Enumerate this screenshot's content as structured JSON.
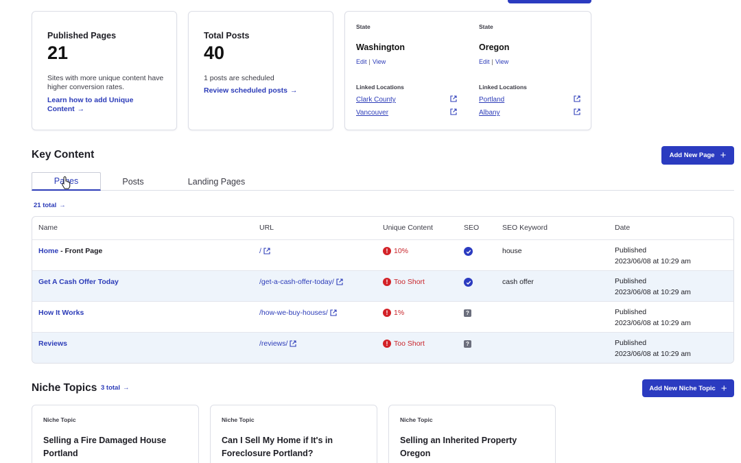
{
  "stats": {
    "published": {
      "title": "Published Pages",
      "value": "21",
      "desc": "Sites with more unique content have higher conversion rates.",
      "link": "Learn how to add Unique Content"
    },
    "posts": {
      "title": "Total Posts",
      "value": "40",
      "desc": "1 posts are scheduled",
      "link": "Review scheduled posts"
    }
  },
  "states": [
    {
      "label": "State",
      "name": "Washington",
      "edit": "Edit",
      "view": "View",
      "linked_label": "Linked Locations",
      "locations": [
        "Clark County",
        "Vancouver"
      ]
    },
    {
      "label": "State",
      "name": "Oregon",
      "edit": "Edit",
      "view": "View",
      "linked_label": "Linked Locations",
      "locations": [
        "Portland",
        "Albany"
      ]
    }
  ],
  "key_content": {
    "title": "Key Content",
    "add_button": "Add New Page",
    "tabs": [
      "Pages",
      "Posts",
      "Landing Pages"
    ],
    "total": "21 total",
    "columns": [
      "Name",
      "URL",
      "Unique Content",
      "SEO",
      "SEO Keyword",
      "Date"
    ],
    "rows": [
      {
        "name": "Home",
        "suffix": " - Front Page",
        "url": "/",
        "unique": "10%",
        "seo": "check",
        "keyword": "house",
        "status": "Published",
        "date": "2023/06/08 at 10:29 am"
      },
      {
        "name": "Get A Cash Offer Today",
        "suffix": "",
        "url": "/get-a-cash-offer-today/",
        "unique": "Too Short",
        "seo": "check",
        "keyword": "cash offer",
        "status": "Published",
        "date": "2023/06/08 at 10:29 am"
      },
      {
        "name": "How It Works",
        "suffix": "",
        "url": "/how-we-buy-houses/",
        "unique": "1%",
        "seo": "unknown",
        "keyword": "",
        "status": "Published",
        "date": "2023/06/08 at 10:29 am"
      },
      {
        "name": "Reviews",
        "suffix": "",
        "url": "/reviews/",
        "unique": "Too Short",
        "seo": "unknown",
        "keyword": "",
        "status": "Published",
        "date": "2023/06/08 at 10:29 am"
      }
    ]
  },
  "niche": {
    "title": "Niche Topics",
    "total": "3 total",
    "add_button": "Add New Niche Topic",
    "cards": [
      {
        "label": "Niche Topic",
        "title": "Selling a Fire Damaged House Portland"
      },
      {
        "label": "Niche Topic",
        "title": "Can I Sell My Home if It's in Foreclosure Portland?"
      },
      {
        "label": "Niche Topic",
        "title": "Selling an Inherited Property Oregon"
      }
    ]
  },
  "colors": {
    "accent": "#2b3bc0",
    "alert": "#d32127",
    "row_alt": "#eef4fb"
  }
}
